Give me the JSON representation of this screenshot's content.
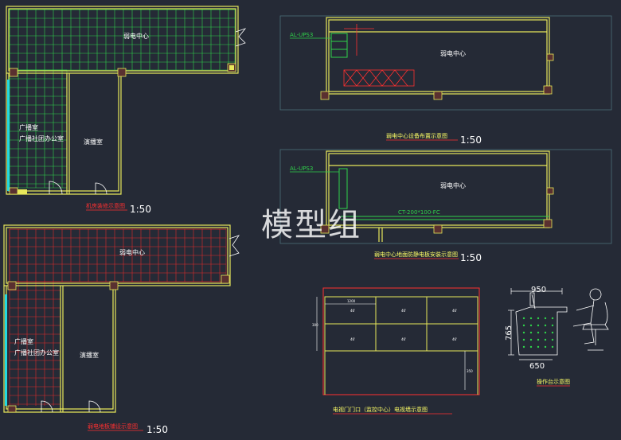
{
  "plans": {
    "top_left": {
      "room_weak": "弱电中心",
      "room_broadcast": "广播室",
      "room_office": "广播社团办公室",
      "room_studio": "演播室",
      "caption": "机房装修示意图",
      "scale": "1:50"
    },
    "bottom_left": {
      "room_weak": "弱电中心",
      "room_broadcast": "广播室",
      "room_office": "广播社团办公室",
      "room_studio": "演播室",
      "caption": "弱电地板铺设示意图",
      "scale": "1:50"
    },
    "top_right": {
      "tag": "AL-UPS3",
      "room": "弱电中心",
      "caption": "弱电中心设备布置示意图",
      "scale": "1:50"
    },
    "middle_right": {
      "tag": "AL-UPS3",
      "room": "弱电中心",
      "tray": "CT-200*100-FC",
      "caption": "弱电中心地面防静电板安装示意图",
      "scale": "1:50"
    }
  },
  "details": {
    "tv_wall": {
      "caption": "电视门门口（监控中心）电视墙示意图",
      "screen_label": "46'",
      "dims": {
        "top": "1200",
        "side": "300",
        "right": "350"
      }
    },
    "console": {
      "caption": "操作台示意图",
      "dim_top": "950",
      "dim_side": "765",
      "dim_bottom": "650"
    }
  },
  "watermark": "模型组",
  "colors": {
    "background": "#252a36",
    "wall": "#e8e85a",
    "grid_green": "#2fd24a",
    "grid_red": "#e02a2a",
    "cyan": "#22d8e0",
    "annotation_red": "#ff3030",
    "text": "#ffffff",
    "frame": "#4a6f7a"
  }
}
